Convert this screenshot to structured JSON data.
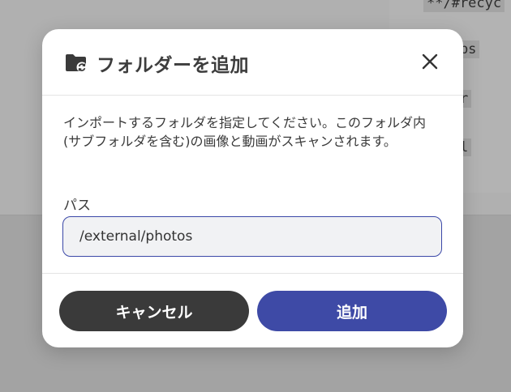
{
  "background": {
    "code_lines": [
      "**/#recyc",
      "!snaps",
      "stver",
      "stfol"
    ]
  },
  "dialog": {
    "icon": "folder-sync-icon",
    "title": "フォルダーを追加",
    "close_icon": "close-icon",
    "description": "インポートするフォルダを指定してください。このフォルダ内(サブフォルダを含む)の画像と動画がスキャンされます。",
    "path_label": "パス",
    "path_value": "/external/photos",
    "cancel_label": "キャンセル",
    "add_label": "追加"
  },
  "colors": {
    "primary": "#3e4aa6",
    "cancel": "#3a3a3a",
    "input_border": "#3b48a8",
    "input_bg": "#f1f2f4"
  }
}
